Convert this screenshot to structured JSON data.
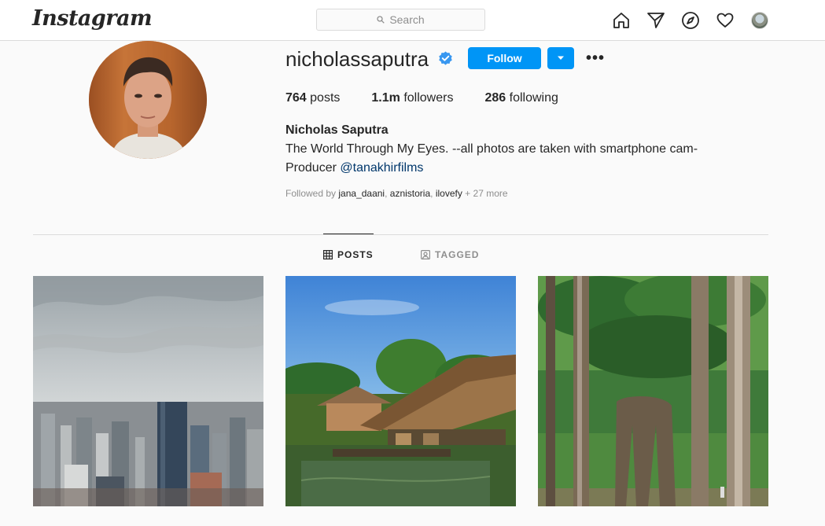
{
  "nav": {
    "logo": "Instagram",
    "search_placeholder": "Search",
    "icons": [
      "home-icon",
      "direct-icon",
      "explore-icon",
      "activity-icon",
      "profile-avatar"
    ]
  },
  "profile": {
    "username": "nicholassaputra",
    "verified": true,
    "follow_label": "Follow",
    "more_label": "•••",
    "stats": {
      "posts_count": "764",
      "posts_label": "posts",
      "followers_count": "1.1m",
      "followers_label": "followers",
      "following_count": "286",
      "following_label": "following"
    },
    "full_name": "Nicholas Saputra",
    "bio_line1": "The World Through My Eyes. --all photos are taken with smartphone cam-",
    "bio_line2_prefix": "Producer",
    "bio_mention": "@tanakhirfilms",
    "followed_by_prefix": "Followed by",
    "followed_by_names": [
      "jana_daani",
      "aznistoria",
      "ilovefy"
    ],
    "followed_by_more": "+ 27 more"
  },
  "tabs": [
    {
      "label": "POSTS",
      "active": true
    },
    {
      "label": "TAGGED",
      "active": false
    }
  ],
  "colors": {
    "accent": "#0095f6",
    "verified": "#3897f0",
    "mention": "#00376b"
  }
}
